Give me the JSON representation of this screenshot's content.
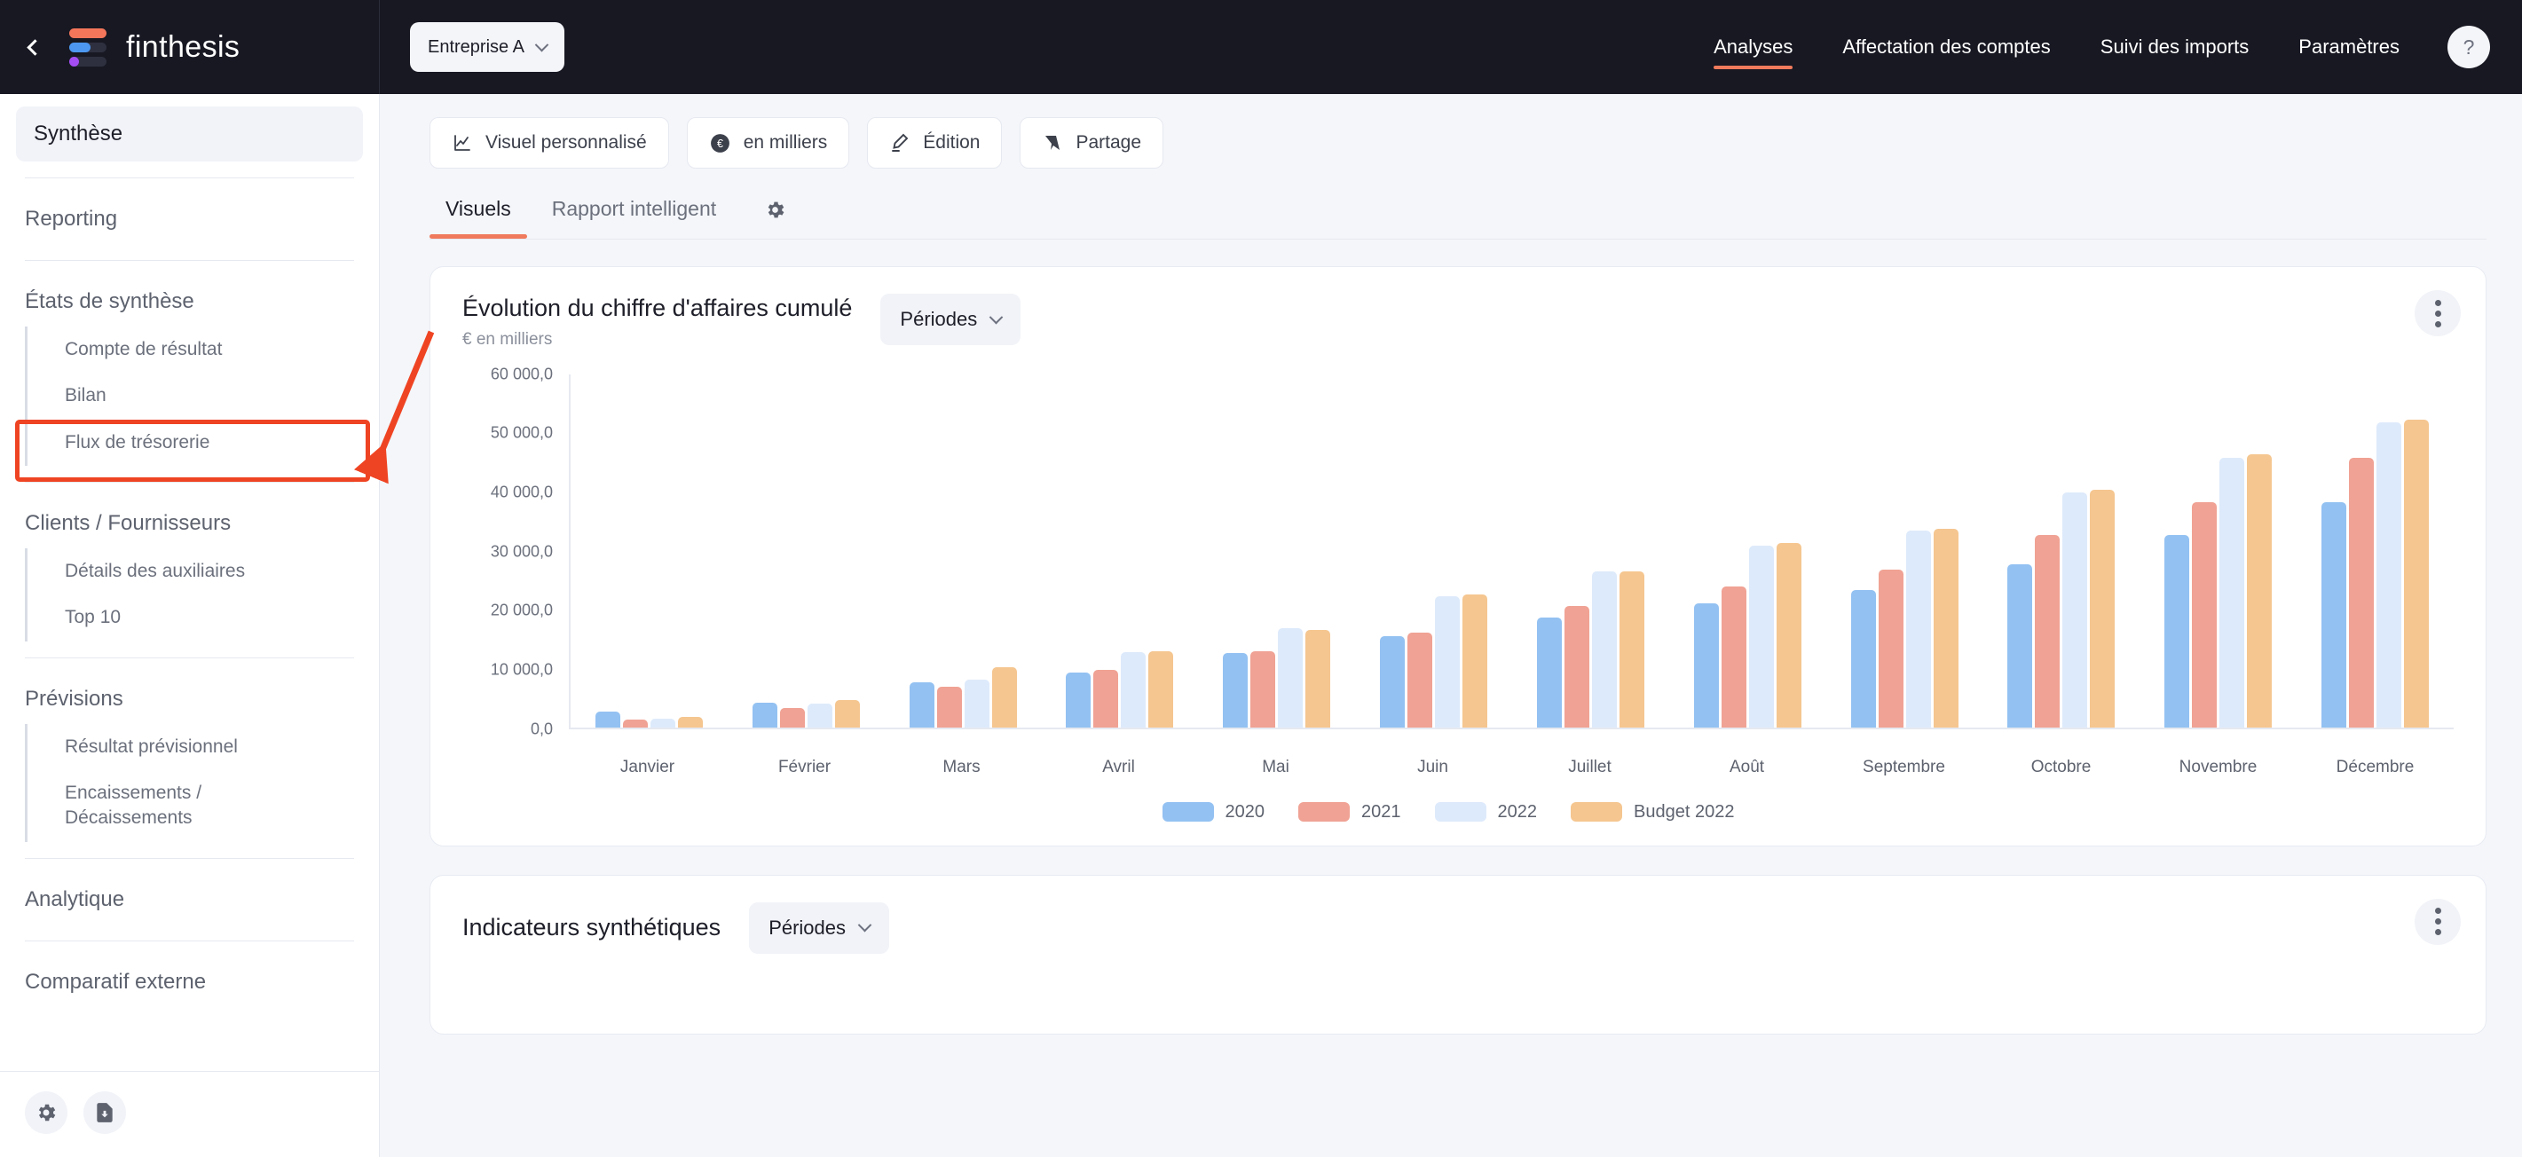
{
  "brand": {
    "name": "finthesis",
    "collapse_icon": "chevron-left-icon",
    "logo_icon": "finthesis-logo-icon"
  },
  "topbar": {
    "company_selector": {
      "label": "Entreprise A",
      "chevron_icon": "chevron-down-icon"
    },
    "nav": [
      {
        "label": "Analyses",
        "active": true
      },
      {
        "label": "Affectation des comptes",
        "active": false
      },
      {
        "label": "Suivi des imports",
        "active": false
      },
      {
        "label": "Paramètres",
        "active": false
      }
    ],
    "help": {
      "label": "?",
      "icon": "help-circle-icon"
    }
  },
  "sidebar": {
    "top_item": {
      "label": "Synthèse"
    },
    "groups": [
      {
        "title": "Reporting",
        "items": []
      },
      {
        "title": "États de synthèse",
        "items": [
          {
            "label": "Compte de résultat",
            "highlighted": true
          },
          {
            "label": "Bilan",
            "highlighted": false
          },
          {
            "label": "Flux de trésorerie",
            "highlighted": false
          }
        ]
      },
      {
        "title": "Clients / Fournisseurs",
        "items": [
          {
            "label": "Détails des auxiliaires",
            "highlighted": false
          },
          {
            "label": "Top 10",
            "highlighted": false
          }
        ]
      },
      {
        "title": "Prévisions",
        "items": [
          {
            "label": "Résultat prévisionnel",
            "highlighted": false
          },
          {
            "label": "Encaissements / Décaissements",
            "highlighted": false
          }
        ]
      },
      {
        "title": "Analytique",
        "items": []
      },
      {
        "title": "Comparatif externe",
        "items": []
      }
    ],
    "footer_icons": [
      {
        "name": "gear-icon"
      },
      {
        "name": "file-download-icon"
      }
    ]
  },
  "toolbar": {
    "buttons": [
      {
        "label": "Visuel personnalisé",
        "icon": "line-chart-icon"
      },
      {
        "label": "en milliers",
        "icon": "euro-circle-icon"
      },
      {
        "label": "Édition",
        "icon": "pencil-icon"
      },
      {
        "label": "Partage",
        "icon": "share-icon"
      }
    ]
  },
  "tabs": {
    "items": [
      {
        "label": "Visuels",
        "active": true
      },
      {
        "label": "Rapport intelligent",
        "active": false
      }
    ],
    "settings_icon": "gear-icon"
  },
  "cards": {
    "chart_card": {
      "title": "Évolution du chiffre d'affaires cumulé",
      "subtitle": "€ en milliers",
      "period_selector": {
        "label": "Périodes",
        "chevron_icon": "chevron-down-icon"
      },
      "menu_icon": "kebab-menu-icon"
    },
    "indicators_card": {
      "title": "Indicateurs synthétiques",
      "period_selector": {
        "label": "Périodes",
        "chevron_icon": "chevron-down-icon"
      },
      "menu_icon": "kebab-menu-icon"
    }
  },
  "colors": {
    "accent": "#ef7a5c",
    "annotation": "#ef4423",
    "series_2020": "#93c1f2",
    "series_2021": "#f0a294",
    "series_2022": "#ddeafb",
    "series_budget": "#f5c690"
  },
  "chart_data": {
    "type": "bar",
    "title": "Évolution du chiffre d'affaires cumulé",
    "subtitle": "€ en milliers",
    "xlabel": "",
    "ylabel": "",
    "ylim": [
      0,
      60000
    ],
    "ytick_labels": [
      "60 000,0",
      "50 000,0",
      "40 000,0",
      "30 000,0",
      "20 000,0",
      "10 000,0",
      "0,0"
    ],
    "yticks": [
      60000,
      50000,
      40000,
      30000,
      20000,
      10000,
      0
    ],
    "grid": false,
    "legend_position": "bottom",
    "categories": [
      "Janvier",
      "Février",
      "Mars",
      "Avril",
      "Mai",
      "Juin",
      "Juillet",
      "Août",
      "Septembre",
      "Octobre",
      "Novembre",
      "Décembre"
    ],
    "series": [
      {
        "name": "2020",
        "color": "#93c1f2",
        "values": [
          2600,
          4200,
          7600,
          9200,
          12500,
          15400,
          18500,
          21000,
          23200,
          27500,
          32500,
          38000
        ]
      },
      {
        "name": "2021",
        "color": "#f0a294",
        "values": [
          1300,
          3200,
          6900,
          9700,
          12800,
          16000,
          20500,
          23800,
          26600,
          32500,
          38000,
          45500
        ]
      },
      {
        "name": "2022",
        "color": "#ddeafb",
        "values": [
          1500,
          4000,
          8100,
          12700,
          16700,
          22200,
          26400,
          30700,
          33200,
          39700,
          45500,
          51500
        ]
      },
      {
        "name": "Budget 2022",
        "color": "#f5c690",
        "values": [
          1700,
          4600,
          10100,
          12800,
          16400,
          22400,
          26400,
          31100,
          33500,
          40200,
          46200,
          52000
        ]
      }
    ]
  }
}
